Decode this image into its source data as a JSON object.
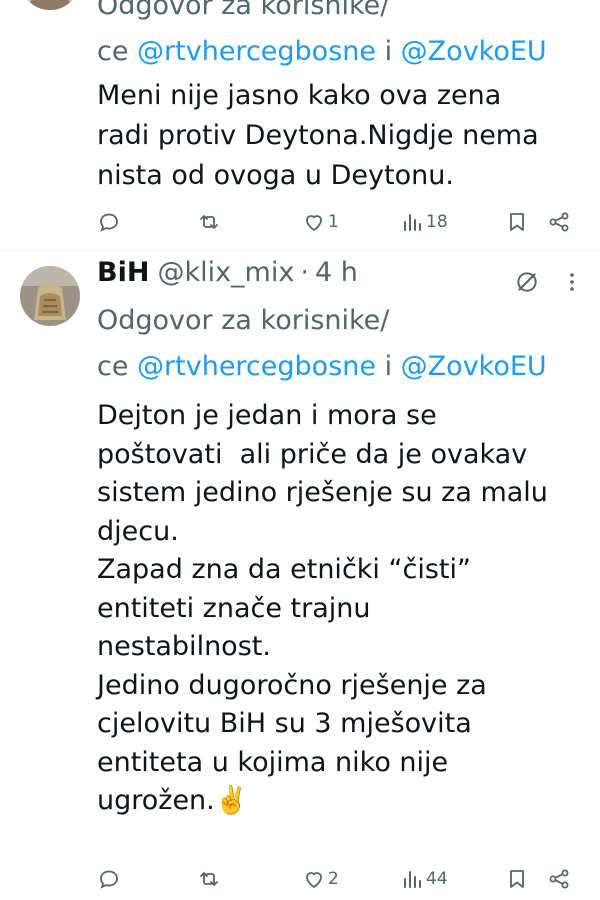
{
  "tweet1": {
    "reply_prefix_a": "Odgovor za korisnike/",
    "reply_prefix_b": "ce ",
    "mention1": "@rtvhercegbosne",
    "and_word": " i ",
    "mention2": "@ZovkoEU",
    "body": "Meni nije jasno kako ova zena\nradi protiv Deytona.Nigdje nema\nnista od ovoga u Deytonu.",
    "likes": "1",
    "views": "18"
  },
  "tweet2": {
    "display_name": "BiH",
    "handle": "@klix_mix",
    "separator": "·",
    "time": "4 h",
    "reply_prefix_a": "Odgovor za korisnike/",
    "reply_prefix_b": "ce ",
    "mention1": "@rtvhercegbosne",
    "and_word": " i ",
    "mention2": "@ZovkoEU",
    "body": "Dejton je jedan i mora se\npoštovati  ali priče da je ovakav\nsistem jedino rješenje su za malu\ndjecu.\nZapad zna da etnički “čisti”\nentiteti znače trajnu\nnestabilnost.\nJedino dugoročno rješenje za\ncjelovitu BiH su 3 mješovita\nentiteta u kojima niko nije\nugrožen.✌️",
    "likes": "2",
    "views": "44"
  },
  "colors": {
    "accent": "#1d9bf0",
    "secondary_text": "#536471",
    "primary_text": "#0f1419"
  },
  "icons": [
    "reply-icon",
    "retweet-icon",
    "like-icon",
    "views-icon",
    "bookmark-icon",
    "share-icon",
    "grok-icon",
    "more-icon"
  ]
}
